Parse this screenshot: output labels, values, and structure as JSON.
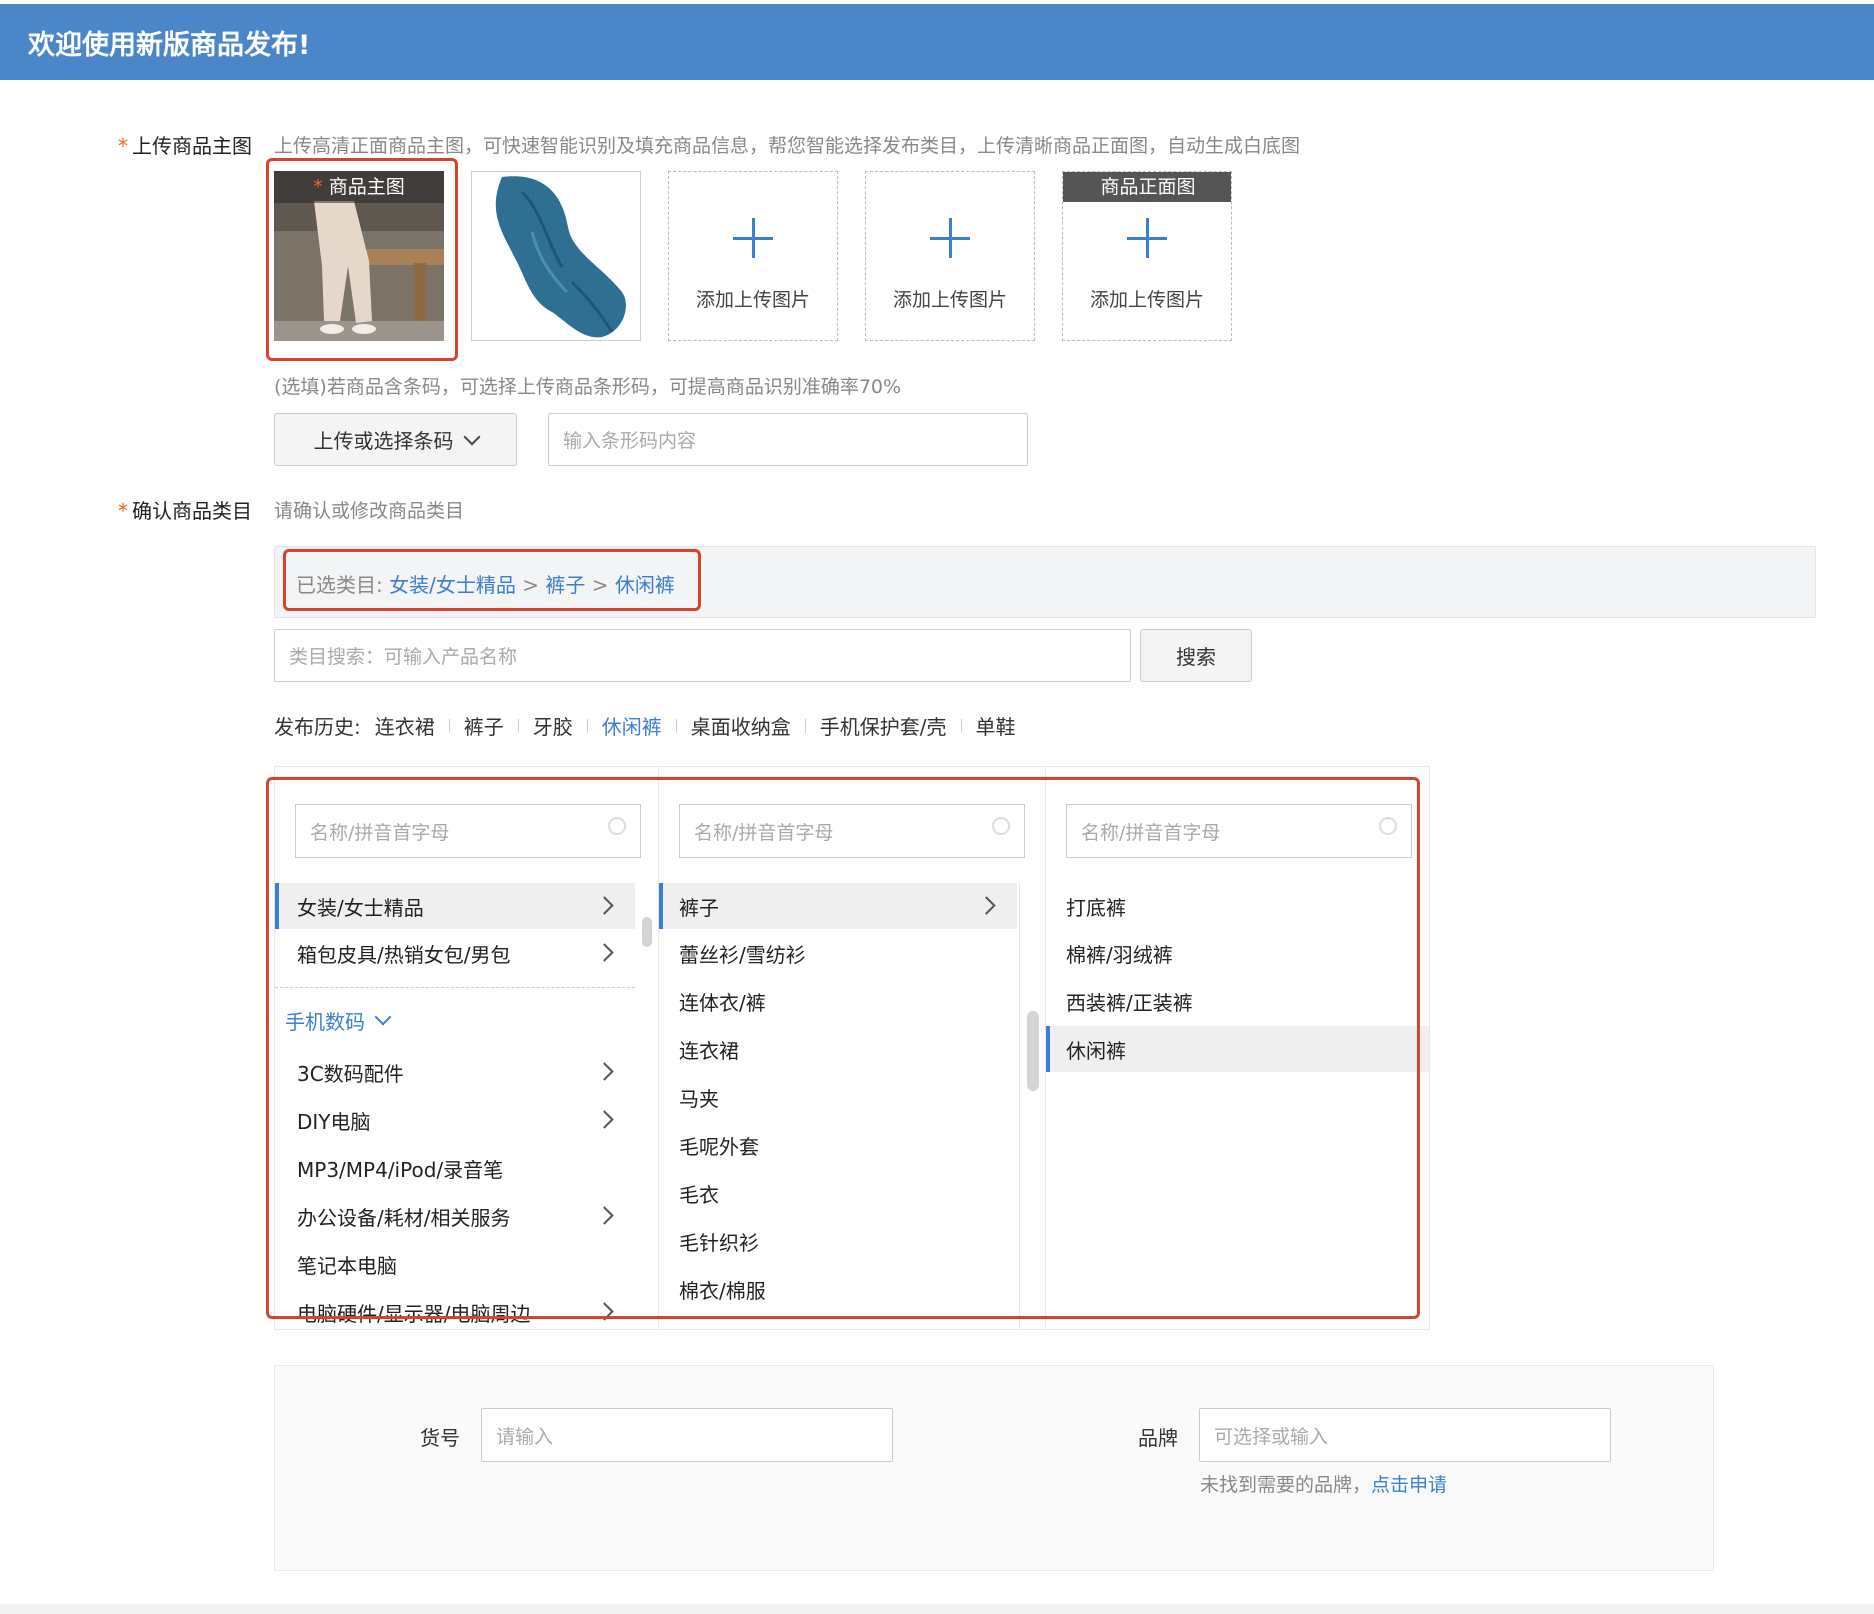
{
  "banner": {
    "title": "欢迎使用新版商品发布!"
  },
  "upload": {
    "label": "上传商品主图",
    "hint": "上传高清正面商品主图，可快速智能识别及填充商品信息，帮您智能选择发布类目，上传清晰商品正面图，自动生成白底图",
    "main_tag": "商品主图",
    "add_label": "添加上传图片",
    "front_tag": "商品正面图",
    "barcode_hint": "(选填)若商品含条码，可选择上传商品条形码，可提高商品识别准确率70%",
    "barcode_button": "上传或选择条码",
    "barcode_placeholder": "输入条形码内容"
  },
  "category": {
    "label": "确认商品类目",
    "hint": "请确认或修改商品类目",
    "selected_prefix": "已选类目:",
    "selected_path": [
      "女装/女士精品",
      "裤子",
      "休闲裤"
    ],
    "path_sep": ">",
    "search_placeholder": "类目搜索：可输入产品名称",
    "search_button": "搜索",
    "history_label": "发布历史:",
    "history": [
      "连衣裙",
      "裤子",
      "牙胶",
      "休闲裤",
      "桌面收纳盒",
      "手机保护套/壳",
      "单鞋"
    ],
    "history_active": "休闲裤",
    "column_placeholder": "名称/拼音首字母",
    "col1": {
      "items": [
        "女装/女士精品",
        "箱包皮具/热销女包/男包"
      ],
      "group": "手机数码",
      "group_items": [
        "3C数码配件",
        "DIY电脑",
        "MP3/MP4/iPod/录音笔",
        "办公设备/耗材/相关服务",
        "笔记本电脑",
        "电脑硬件/显示器/电脑周边"
      ]
    },
    "col2": {
      "items": [
        "裤子",
        "蕾丝衫/雪纺衫",
        "连体衣/裤",
        "连衣裙",
        "马夹",
        "毛呢外套",
        "毛衣",
        "毛针织衫",
        "棉衣/棉服"
      ]
    },
    "col3": {
      "items": [
        "打底裤",
        "棉裤/羽绒裤",
        "西装裤/正装裤",
        "休闲裤"
      ]
    }
  },
  "form": {
    "sku_label": "货号",
    "sku_placeholder": "请输入",
    "brand_label": "品牌",
    "brand_placeholder": "可选择或输入",
    "brand_note": "未找到需要的品牌，",
    "brand_link": "点击申请"
  },
  "colors": {
    "brand_blue": "#4a86c8",
    "link_blue": "#3b7fd0",
    "highlight_red": "#d9422e",
    "required_star": "#f26522"
  }
}
